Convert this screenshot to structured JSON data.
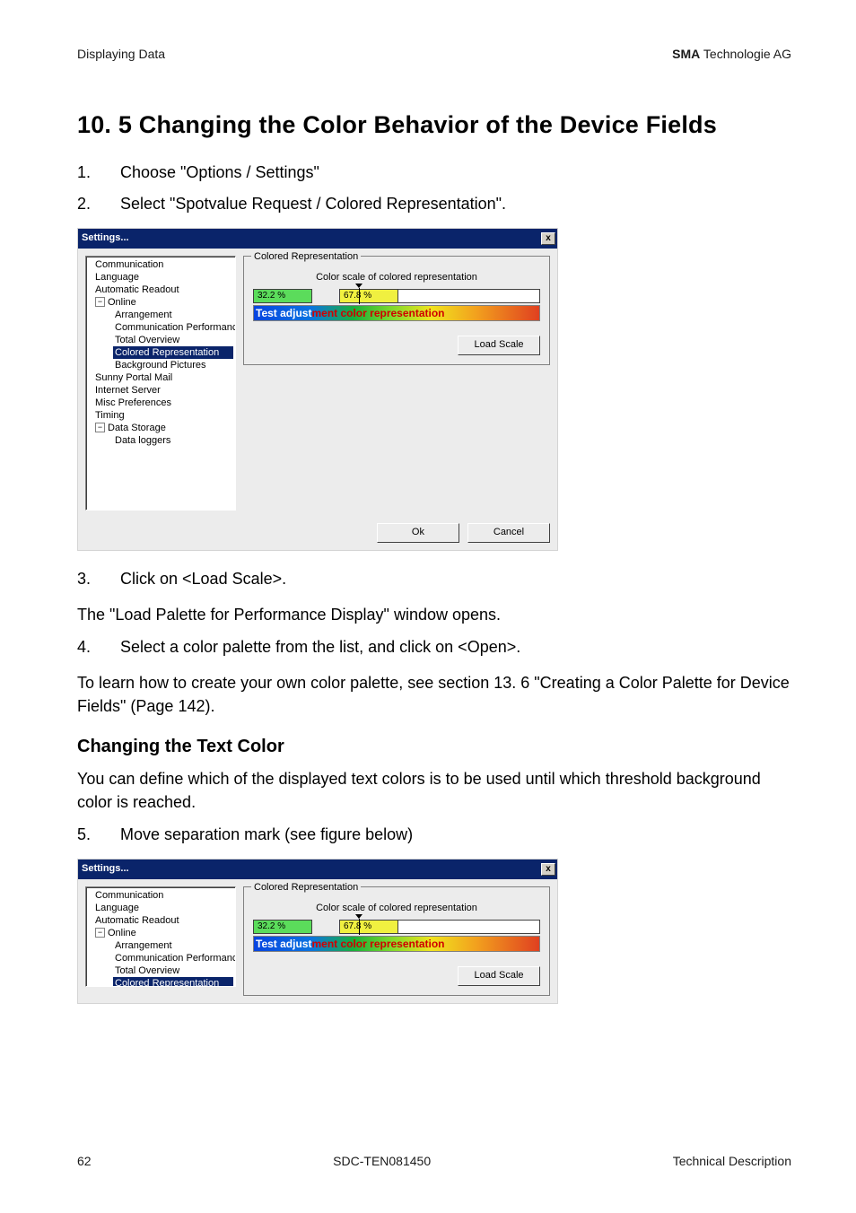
{
  "header": {
    "left": "Displaying Data",
    "right_bold": "SMA",
    "right_rest": " Technologie AG"
  },
  "section_title": "10. 5 Changing the Color Behavior of the Device Fields",
  "steps_a": [
    {
      "n": "1.",
      "t": "Choose \"Options / Settings\""
    },
    {
      "n": "2.",
      "t": "Select \"Spotvalue Request / Colored Representation\"."
    }
  ],
  "dialog": {
    "title": "Settings...",
    "close": "x",
    "tree": {
      "items": [
        {
          "label": "Communication",
          "lvl": 0
        },
        {
          "label": "Language",
          "lvl": 0
        },
        {
          "label": "Automatic Readout",
          "lvl": 0
        },
        {
          "label": "Online",
          "lvl": 1,
          "minus": true
        },
        {
          "label": "Arrangement",
          "lvl": 2
        },
        {
          "label": "Communication Performance",
          "lvl": 2
        },
        {
          "label": "Total Overview",
          "lvl": 2
        },
        {
          "label": "Colored Representation",
          "lvl": 2,
          "sel": true
        },
        {
          "label": "Background Pictures",
          "lvl": 2
        },
        {
          "label": "Sunny Portal Mail",
          "lvl": 0
        },
        {
          "label": "Internet Server",
          "lvl": 0
        },
        {
          "label": "Misc Preferences",
          "lvl": 0
        },
        {
          "label": "Timing",
          "lvl": 0
        },
        {
          "label": "Data Storage",
          "lvl": 1,
          "minus": true
        },
        {
          "label": "Data loggers",
          "lvl": 2
        }
      ]
    },
    "group": {
      "legend": "Colored Representation",
      "scale_caption": "Color scale of colored representation",
      "left_val": "32.2 %",
      "right_val": "67.8 %",
      "grad_white": "Test adjust",
      "grad_red": "ment color representation",
      "load_scale": "Load Scale"
    },
    "ok": "Ok",
    "cancel": "Cancel"
  },
  "steps_b": [
    {
      "n": "3.",
      "t": "Click on <Load Scale>."
    }
  ],
  "after3_indent": "The \"Load Palette for Performance Display\" window opens.",
  "steps_c": [
    {
      "n": "4.",
      "t": "Select a color palette from the list, and click on <Open>."
    }
  ],
  "after4_indent": "To learn how to create your own color palette, see section 13. 6 \"Creating a Color Palette for Device Fields\" (Page 142).",
  "subhead": "Changing the Text Color",
  "subhead_body": "You can define which of the displayed text colors is to be used until which threshold background color is reached.",
  "steps_d": [
    {
      "n": "5.",
      "t": "Move separation mark (see figure below)"
    }
  ],
  "dialog2_tree_items": [
    {
      "label": "Communication",
      "lvl": 0
    },
    {
      "label": "Language",
      "lvl": 0
    },
    {
      "label": "Automatic Readout",
      "lvl": 0
    },
    {
      "label": "Online",
      "lvl": 1,
      "minus": true
    },
    {
      "label": "Arrangement",
      "lvl": 2
    },
    {
      "label": "Communication Performance",
      "lvl": 2
    },
    {
      "label": "Total Overview",
      "lvl": 2
    },
    {
      "label": "Colored Representation",
      "lvl": 2,
      "sel": true
    }
  ],
  "footer": {
    "left": "62",
    "mid": "SDC-TEN081450",
    "right": "Technical Description"
  }
}
